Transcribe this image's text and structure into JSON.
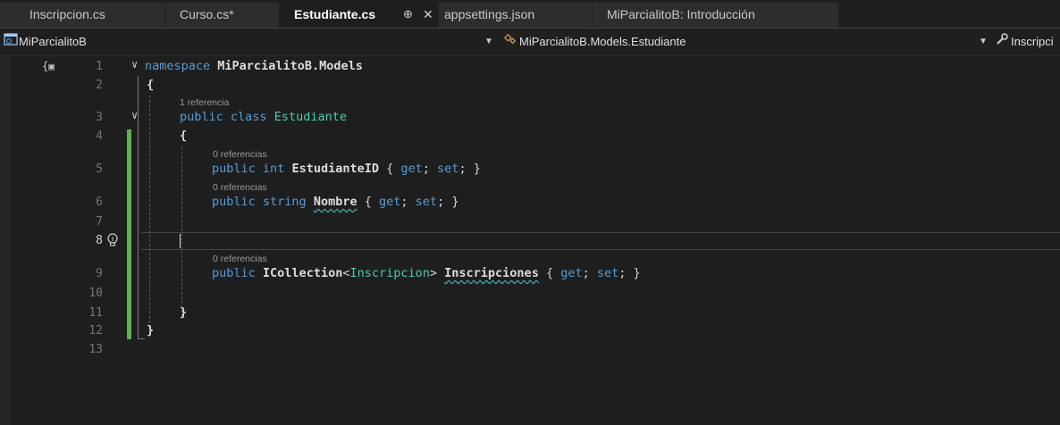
{
  "tabs": [
    {
      "label": "Inscripcion.cs",
      "active": false
    },
    {
      "label": "Curso.cs*",
      "active": false
    },
    {
      "label": "Estudiante.cs",
      "active": true,
      "pin": "⊕",
      "close": "✕"
    },
    {
      "label": "appsettings.json",
      "active": false
    },
    {
      "label": "MiParcialitoB: Introducción",
      "active": false
    }
  ],
  "nav": {
    "project": "MiParcialitoB",
    "class": "MiParcialitoB.Models.Estudiante",
    "member": "Inscripci"
  },
  "editor": {
    "current_line": 8,
    "references": {
      "one": "1 referencia",
      "zero": "0 referencias"
    },
    "lines": {
      "l1": {
        "kw": "namespace",
        "name": "MiParcialitoB.Models"
      },
      "l2": "{",
      "l3": {
        "kw1": "public",
        "kw2": "class",
        "name": "Estudiante"
      },
      "l4": "{",
      "l5": {
        "kw1": "public",
        "kw2": "int",
        "name": "EstudianteID",
        "rest_open": " { ",
        "get": "get",
        "semi1": "; ",
        "set": "set",
        "semi2": "; }"
      },
      "l6": {
        "kw1": "public",
        "kw2": "string",
        "name": "Nombre",
        "rest_open": " { ",
        "get": "get",
        "semi1": "; ",
        "set": "set",
        "semi2": "; }"
      },
      "l9": {
        "kw1": "public",
        "type": "ICollection",
        "lt": "<",
        "generic": "Inscripcion",
        "gt": ">",
        "name": "Inscripciones",
        "rest_open": " { ",
        "get": "get",
        "semi1": "; ",
        "set": "set",
        "semi2": "; }"
      },
      "l11": "}",
      "l12": "}"
    },
    "line_numbers": [
      "1",
      "2",
      "3",
      "4",
      "5",
      "6",
      "7",
      "8",
      "9",
      "10",
      "11",
      "12",
      "13"
    ]
  },
  "colors": {
    "keyword": "#569cd6",
    "type": "#4ec9b0",
    "change_bar": "#5fb04f",
    "background": "#1e1e1e"
  }
}
